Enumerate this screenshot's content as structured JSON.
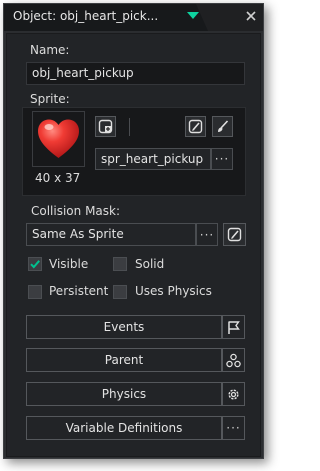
{
  "window": {
    "title": "Object: obj_heart_pick..."
  },
  "name": {
    "label": "Name:",
    "value": "obj_heart_pickup"
  },
  "sprite": {
    "label": "Sprite:",
    "value": "spr_heart_pickup",
    "dimensions": "40 x 37",
    "browse_label": "···"
  },
  "collision": {
    "label": "Collision Mask:",
    "value": "Same As Sprite",
    "browse_label": "···"
  },
  "options": {
    "visible": {
      "label": "Visible",
      "checked": true
    },
    "solid": {
      "label": "Solid",
      "checked": false
    },
    "persistent": {
      "label": "Persistent",
      "checked": false
    },
    "uses_physics": {
      "label": "Uses Physics",
      "checked": false
    }
  },
  "buttons": {
    "events": "Events",
    "parent": "Parent",
    "physics": "Physics",
    "variable_definitions": "Variable Definitions",
    "more_label": "···"
  },
  "colors": {
    "accent": "#00c18e",
    "window_bg": "#2b2d30",
    "panel_bg": "#222427",
    "field_bg": "#17181a",
    "text": "#e4e4e4",
    "heart": "#e8312f"
  }
}
